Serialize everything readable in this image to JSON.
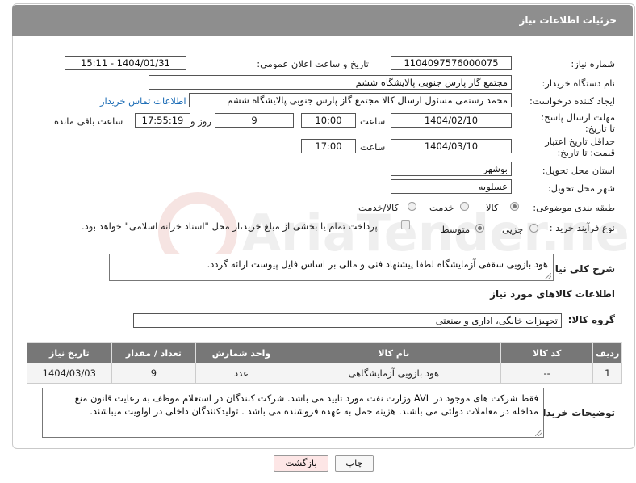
{
  "header": {
    "title": "جزئیات اطلاعات نیاز"
  },
  "fields": {
    "need_number_label": "شماره نیاز:",
    "need_number": "1104097576000075",
    "announce_label": "تاریخ و ساعت اعلان عمومی:",
    "announce_value": "1404/01/31 - 15:11",
    "buyer_org_label": "نام دستگاه خریدار:",
    "buyer_org": "مجتمع گاز پارس جنوبی  پالایشگاه ششم",
    "requester_label": "ایجاد کننده درخواست:",
    "requester": "محمد رستمی مسئول ارسال کالا مجتمع گاز پارس جنوبی  پالایشگاه ششم",
    "contact_link": "اطلاعات تماس خریدار",
    "deadline_label": "مهلت ارسال پاسخ: تا تاریخ:",
    "deadline_date": "1404/02/10",
    "time_word": "ساعت",
    "deadline_time": "10:00",
    "days_value": "9",
    "days_word": "روز و",
    "remaining_time": "17:55:19",
    "remaining_word": "ساعت باقی مانده",
    "price_validity_label": "حداقل تاریخ اعتبار قیمت: تا تاریخ:",
    "price_validity_date": "1404/03/10",
    "price_validity_time": "17:00",
    "province_label": "استان محل تحویل:",
    "province": "بوشهر",
    "city_label": "شهر محل تحویل:",
    "city": "عسلویه",
    "category_label": "طبقه بندی موضوعی:",
    "category_options": [
      "کالا",
      "خدمت",
      "کالا/خدمت"
    ],
    "category_selected": "کالا",
    "process_label": "نوع فرآیند خرید :",
    "process_options": [
      "جزیی",
      "متوسط"
    ],
    "process_selected": "متوسط",
    "payment_note": "پرداخت تمام یا بخشی از مبلغ خرید،از محل \"اسناد خزانه اسلامی\" خواهد بود.",
    "description_label": "شرح کلی نیاز:",
    "description": "هود بازویی سقفی آزمایشگاه لطفا پیشنهاد فنی و مالی بر اساس فایل پیوست ارائه گردد."
  },
  "goods_section": {
    "title": "اطلاعات کالاهای مورد نیاز",
    "group_label": "گروه کالا:",
    "group_value": "تجهیزات خانگی، اداری و صنعتی"
  },
  "table": {
    "headers": [
      "ردیف",
      "کد کالا",
      "نام کالا",
      "واحد شمارش",
      "تعداد / مقدار",
      "تاریخ نیاز"
    ],
    "rows": [
      [
        "1",
        "--",
        "هود بازویی آزمایشگاهی",
        "عدد",
        "9",
        "1404/03/03"
      ]
    ]
  },
  "buyer_notes": {
    "label": "توضیحات خریدار:",
    "text": "فقط شرکت های موجود در AVL وزارت نفت مورد تایید می باشد. شرکت کنندگان در استعلام موظف به رعایت قانون منع مداخله در معاملات دولتی می باشند. هزینه حمل به عهده فروشنده می باشد . تولیدکنندگان داخلی در اولویت میباشند."
  },
  "buttons": {
    "print": "چاپ",
    "back": "بازگشت"
  },
  "watermark": {
    "text": "AriaTender.net"
  },
  "colors": {
    "header_bg": "#8e8e8e",
    "table_header_bg": "#777777",
    "link": "#1a6bb5",
    "back_button_bg": "#fde6e6"
  }
}
